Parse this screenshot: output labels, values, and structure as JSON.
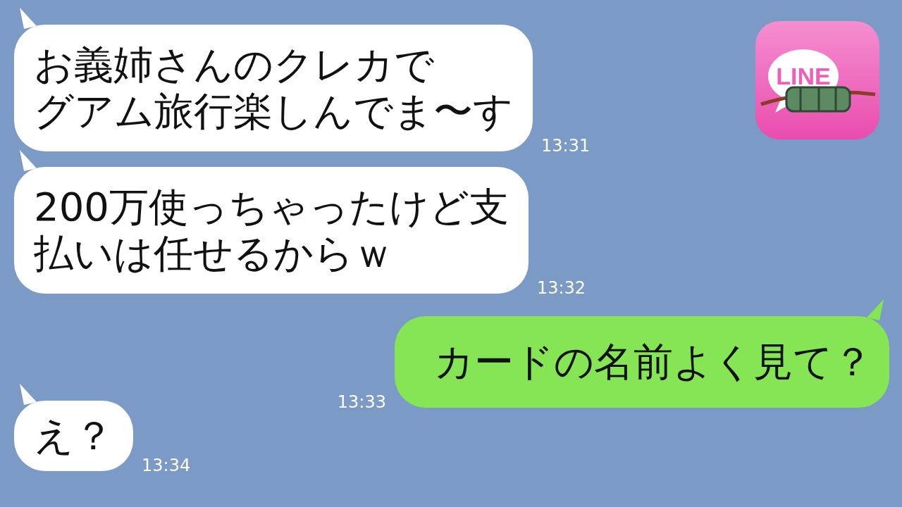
{
  "messages": [
    {
      "kind": "received",
      "lines": [
        "お義姉さんのクレカで",
        "グアム旅行楽しんでま〜す"
      ],
      "time": "13:31"
    },
    {
      "kind": "received",
      "lines": [
        "200万使っちゃったけど支",
        "払いは任せるからｗ"
      ],
      "time": "13:32"
    },
    {
      "kind": "sent",
      "lines": [
        "カードの名前よく見て？"
      ],
      "time": "13:33"
    },
    {
      "kind": "received",
      "lines": [
        "え？"
      ],
      "time": "13:34"
    }
  ],
  "logo": {
    "label": "LINE"
  }
}
